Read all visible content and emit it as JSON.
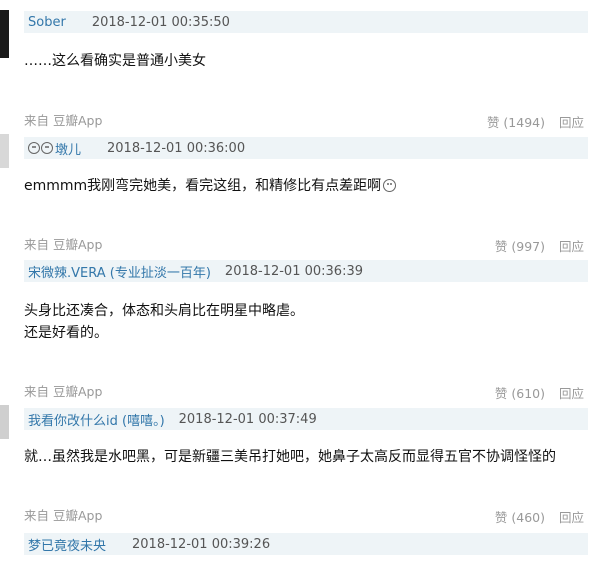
{
  "comments": [
    {
      "author": "Sober",
      "time": "2018-12-01 00:35:50",
      "lines": [
        "……这么看确实是普通小美女"
      ],
      "source": "来自 豆瓣App",
      "likes": "赞 (1494)",
      "reply": "回应"
    },
    {
      "author": "墩儿",
      "time": "2018-12-01 00:36:00",
      "lines": [
        "emmmm我刚弯完她美，看完这组，和精修比有点差距啊"
      ],
      "source": "来自 豆瓣App",
      "likes": "赞 (997)",
      "reply": "回应"
    },
    {
      "author": "宋微辣.VERA (专业扯淡一百年)",
      "time": "2018-12-01 00:36:39",
      "lines": [
        "头身比还凑合，体态和头肩比在明星中略虐。",
        "还是好看的。"
      ],
      "source": "来自 豆瓣App",
      "likes": "赞 (610)",
      "reply": "回应"
    },
    {
      "author": "我看你改什么id (嘻嘻。)",
      "time": "2018-12-01 00:37:49",
      "lines": [
        "就…虽然我是水吧黑，可是新疆三美吊打她吧，她鼻子太高反而显得五官不协调怪怪的"
      ],
      "source": "来自 豆瓣App",
      "likes": "赞 (460)",
      "reply": "回应"
    },
    {
      "author": "梦已竟夜未央",
      "time": "2018-12-01 00:39:26"
    }
  ]
}
